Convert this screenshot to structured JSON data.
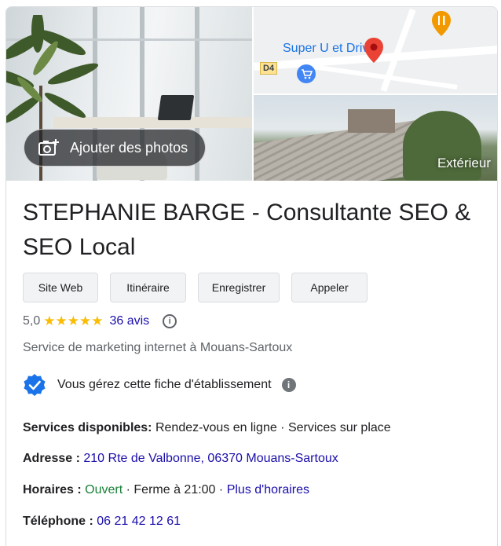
{
  "photos": {
    "add_photos_label": "Ajouter des photos",
    "exterior_label": "Extérieur",
    "map": {
      "store_label": "Super U et Drive",
      "road_label": "D4"
    }
  },
  "business": {
    "name": "STEPHANIE BARGE - Consultante SEO & SEO Local",
    "rating": "5,0",
    "stars": "★★★★★",
    "reviews": "36 avis",
    "category": "Service de marketing internet à Mouans-Sartoux",
    "verified_text": "Vous gérez cette fiche d'établissement"
  },
  "actions": [
    {
      "label": "Site Web"
    },
    {
      "label": "Itinéraire"
    },
    {
      "label": "Enregistrer"
    },
    {
      "label": "Appeler"
    }
  ],
  "details": {
    "services_label": "Services disponibles:",
    "services_value": "Rendez-vous en ligne · Services sur place",
    "address_label": "Adresse :",
    "address_value": "210 Rte de Valbonne, 06370 Mouans-Sartoux",
    "hours_label": "Horaires :",
    "hours_status": "Ouvert",
    "hours_close": "· Ferme à 21:00 ·",
    "hours_more": "Plus d'horaires",
    "phone_label": "Téléphone :",
    "phone_value": "06 21 42 12 61"
  },
  "colors": {
    "link": "#1a0dab",
    "star": "#fbbc04",
    "open": "#188038",
    "verified": "#1a73e8"
  }
}
